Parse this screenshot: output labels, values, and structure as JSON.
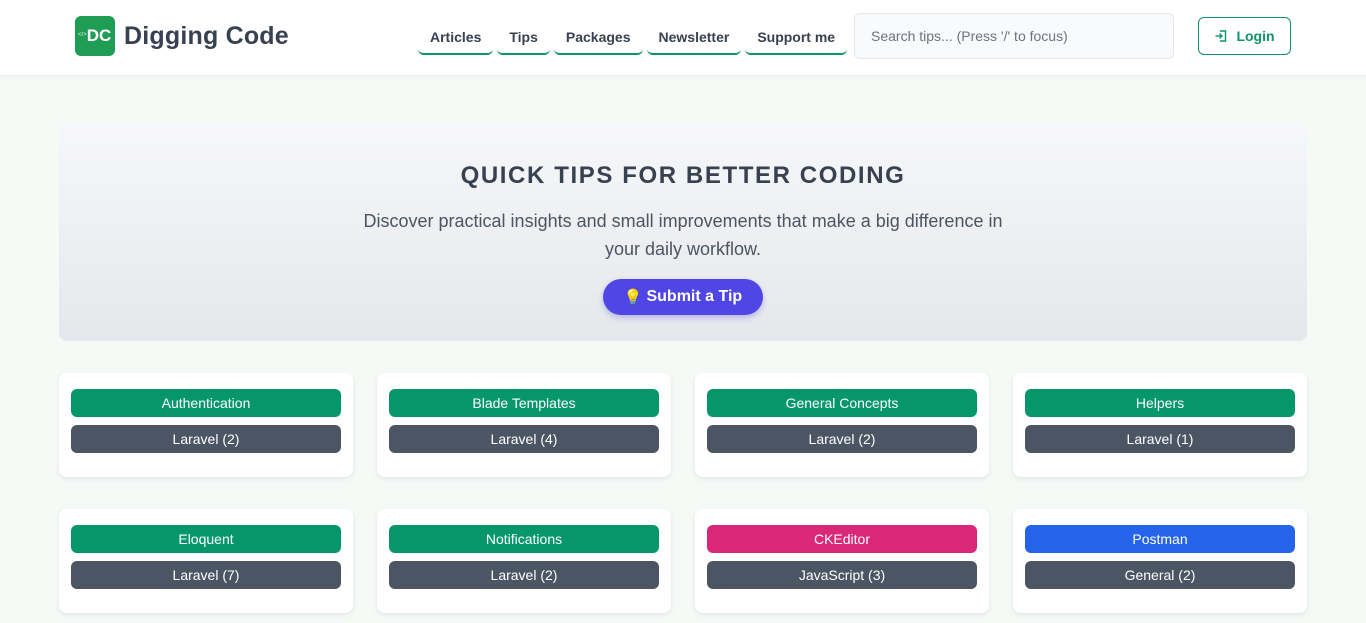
{
  "header": {
    "logo_badge": "DC",
    "logo_badge_small": "</>",
    "brand": "Digging Code",
    "nav": [
      "Articles",
      "Tips",
      "Packages",
      "Newsletter",
      "Support me"
    ],
    "search_placeholder": "Search tips... (Press '/' to focus)",
    "login_label": "Login"
  },
  "hero": {
    "title": "QUICK TIPS FOR BETTER CODING",
    "subtitle": "Discover practical insights and small improvements that make a big difference in your daily workflow.",
    "cta_icon": "💡",
    "cta_label": "Submit a Tip"
  },
  "colors": {
    "brand_green": "#0f9466",
    "topic_green": "#059669",
    "pink": "#db2777",
    "blue": "#2563eb",
    "gray": "#4b5563",
    "indigo": "#4f46e5"
  },
  "cards": [
    {
      "topic": "Authentication",
      "lang": "Laravel (2)",
      "color": "#059669"
    },
    {
      "topic": "Blade Templates",
      "lang": "Laravel (4)",
      "color": "#059669"
    },
    {
      "topic": "General Concepts",
      "lang": "Laravel (2)",
      "color": "#059669"
    },
    {
      "topic": "Helpers",
      "lang": "Laravel (1)",
      "color": "#059669"
    },
    {
      "topic": "Eloquent",
      "lang": "Laravel (7)",
      "color": "#059669"
    },
    {
      "topic": "Notifications",
      "lang": "Laravel (2)",
      "color": "#059669"
    },
    {
      "topic": "CKEditor",
      "lang": "JavaScript (3)",
      "color": "#db2777"
    },
    {
      "topic": "Postman",
      "lang": "General (2)",
      "color": "#2563eb"
    }
  ]
}
